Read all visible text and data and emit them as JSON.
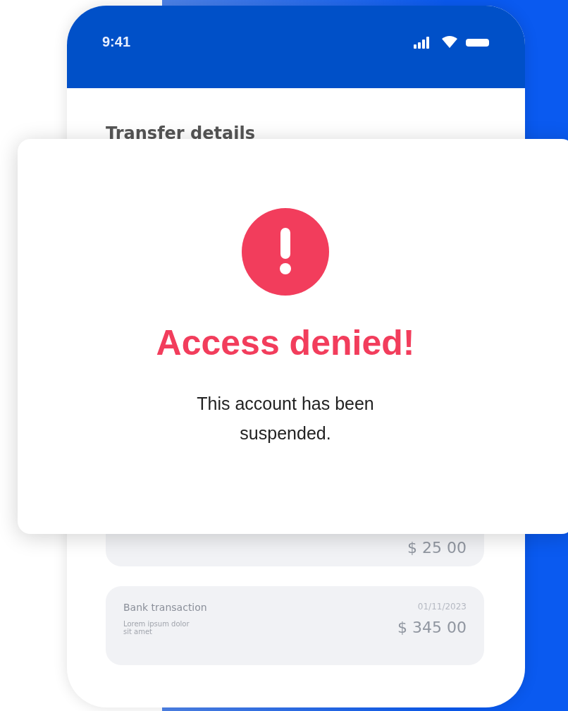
{
  "status_bar": {
    "time": "9:41"
  },
  "screen": {
    "title": "Transfer details",
    "transactions": [
      {
        "amount": "$ 25 00"
      },
      {
        "name": "Bank transaction",
        "description": "Lorem ipsum dolor sit amet",
        "date": "01/11/2023",
        "amount": "$ 345 00"
      }
    ]
  },
  "dialog": {
    "kind": "error",
    "title": "Access denied!",
    "message": "This account has been suspended."
  }
}
